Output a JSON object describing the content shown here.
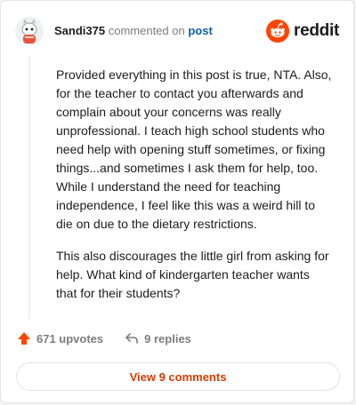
{
  "comment": {
    "username": "Sandi375",
    "action_text": "commented on",
    "post_link": "post",
    "paragraphs": [
      "Provided everything in this post is true, NTA. Also, for the teacher to contact you afterwards and complain about your concerns was really unprofessional. I teach high school students who need help with opening stuff sometimes, or fixing things...and sometimes I ask them for help, too. While I understand the need for teaching independence, I feel like this was a weird hill to die on due to the dietary restrictions.",
      "This also discourages the little girl from asking for help. What kind of kindergarten teacher wants that for their students?"
    ]
  },
  "brand": {
    "wordmark": "reddit",
    "color": "#ff4500"
  },
  "actions": {
    "upvotes": "671 upvotes",
    "replies": "9 replies"
  },
  "view_button": {
    "label": "View 9 comments",
    "color": "#d93a00"
  },
  "icons": {
    "avatar": "snoo-avatar",
    "logo": "reddit-logo-icon",
    "upvote": "upvote-arrow-icon",
    "reply": "reply-arrow-icon"
  }
}
